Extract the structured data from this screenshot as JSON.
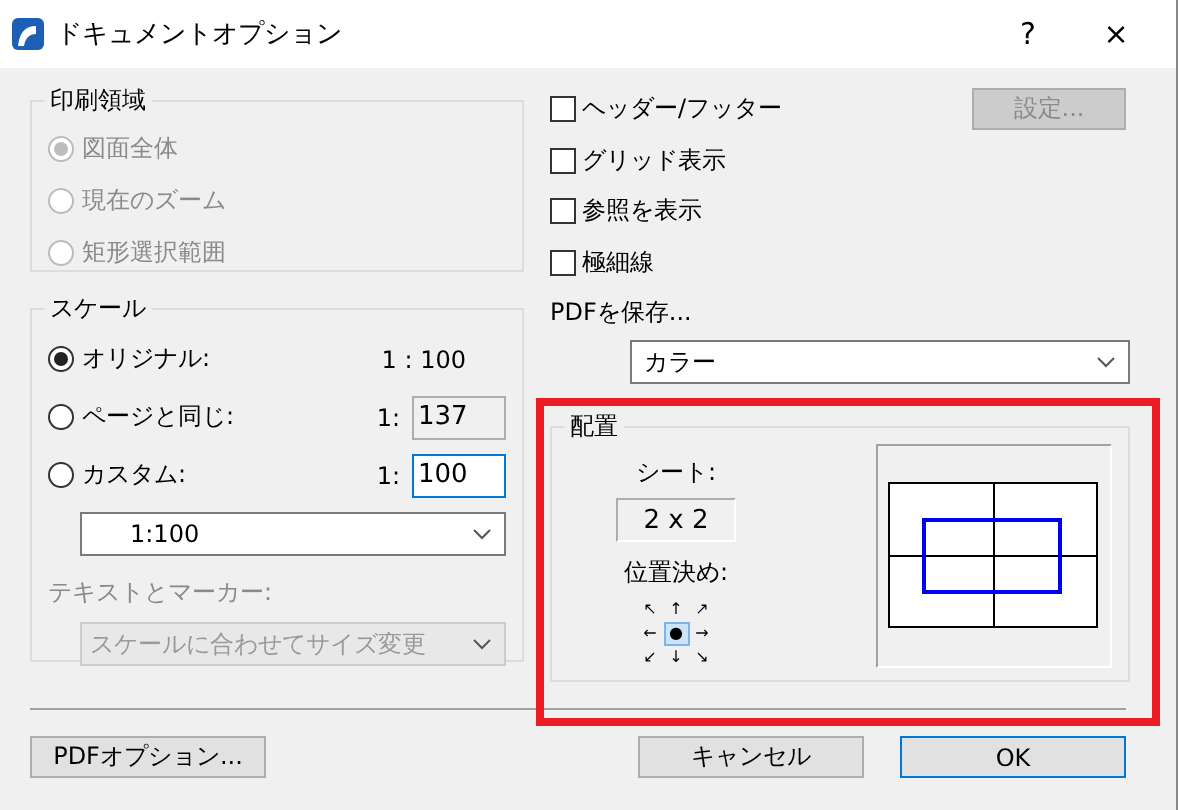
{
  "window": {
    "title": "ドキュメントオプション",
    "help": "?",
    "close": "×"
  },
  "print_area": {
    "title": "印刷領域",
    "disabled": true,
    "options": [
      {
        "label": "図面全体",
        "selected": true
      },
      {
        "label": "現在のズーム",
        "selected": false
      },
      {
        "label": "矩形選択範囲",
        "selected": false
      }
    ]
  },
  "scale": {
    "title": "スケール",
    "options": [
      {
        "label": "オリジナル:",
        "selected": true,
        "kind": "text",
        "prefix": "1 : 100"
      },
      {
        "label": "ページと同じ:",
        "selected": false,
        "kind": "readonly",
        "prefix": "1:",
        "value": "137"
      },
      {
        "label": "カスタム:",
        "selected": false,
        "kind": "input",
        "prefix": "1:",
        "value": "100"
      }
    ],
    "preset": "1:100",
    "text_marker_label": "テキストとマーカー:",
    "text_marker_value": "スケールに合わせてサイズ変更",
    "text_marker_disabled": true
  },
  "checkboxes": [
    {
      "label": "ヘッダー/フッター",
      "checked": false
    },
    {
      "label": "グリッド表示",
      "checked": false
    },
    {
      "label": "参照を表示",
      "checked": false
    },
    {
      "label": "極細線",
      "checked": false
    }
  ],
  "settings_button": {
    "label": "設定...",
    "disabled": true
  },
  "save": {
    "label": "PDFを保存...",
    "value": "カラー"
  },
  "placement": {
    "title": "配置",
    "sheet_label": "シート:",
    "sheet_value": "2 x 2",
    "position_label": "位置決め:",
    "highlighted": true,
    "positions": [
      {
        "glyph": "↖",
        "selected": false
      },
      {
        "glyph": "↑",
        "selected": false
      },
      {
        "glyph": "↗",
        "selected": false
      },
      {
        "glyph": "←",
        "selected": false
      },
      {
        "glyph": "●",
        "selected": true
      },
      {
        "glyph": "→",
        "selected": false
      },
      {
        "glyph": "↙",
        "selected": false
      },
      {
        "glyph": "↓",
        "selected": false
      },
      {
        "glyph": "↘",
        "selected": false
      }
    ]
  },
  "buttons": [
    {
      "label": "PDFオプション...",
      "kind": "secondary"
    },
    {
      "label": "キャンセル",
      "kind": "normal"
    },
    {
      "label": "OK",
      "kind": "default"
    }
  ]
}
